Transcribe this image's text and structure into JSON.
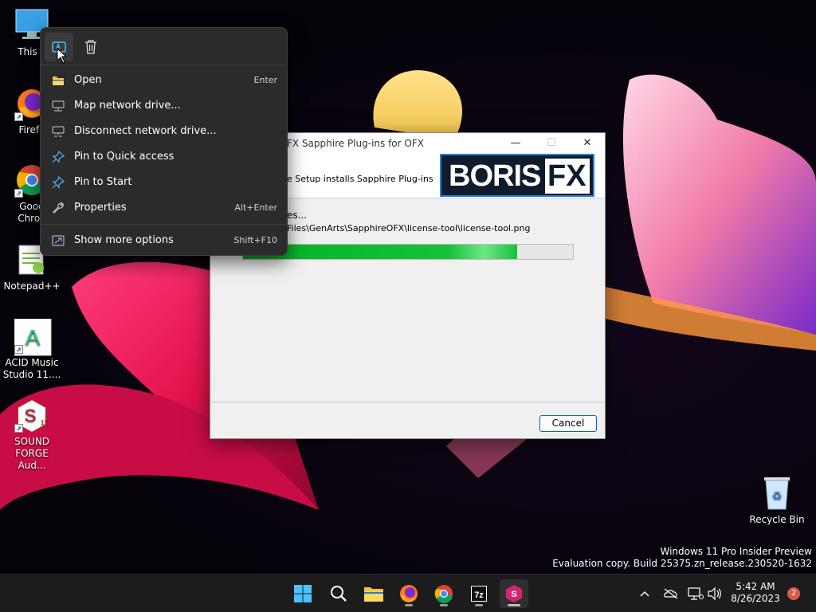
{
  "desktop": {
    "icons": [
      {
        "label": "This P",
        "icon": "monitor-icon"
      },
      {
        "label": "Firefo",
        "icon": "firefox-icon"
      },
      {
        "label": "Goog\nChron",
        "icon": "chrome-icon"
      },
      {
        "label": "Notepad++",
        "icon": "notepadpp-icon"
      },
      {
        "label": "ACID Music\nStudio 11....",
        "icon": "acid-icon"
      },
      {
        "label": "SOUND\nFORGE Aud...",
        "icon": "soundforge-icon"
      }
    ],
    "recycle_bin": {
      "label": "Recycle Bin",
      "icon": "recycle-bin-icon"
    }
  },
  "installer": {
    "title": "FX Sapphire Plug-ins for OFX",
    "header_desc": "e Setup installs Sapphire Plug-ins",
    "logo": {
      "left": "BORIS",
      "right": "FX"
    },
    "status": "es...",
    "path": "Files\\GenArts\\SapphireOFX\\license-tool\\license-tool.png",
    "progress": 0.83,
    "cancel_label": "Cancel"
  },
  "context_menu": {
    "top_buttons": [
      {
        "name": "rename",
        "icon": "rename-icon"
      },
      {
        "name": "delete",
        "icon": "trash-icon"
      }
    ],
    "items": [
      {
        "label": "Open",
        "shortcut": "Enter",
        "icon": "folder-icon"
      },
      {
        "label": "Map network drive...",
        "shortcut": "",
        "icon": "network-drive-icon"
      },
      {
        "label": "Disconnect network drive...",
        "shortcut": "",
        "icon": "disconnect-drive-icon"
      },
      {
        "label": "Pin to Quick access",
        "shortcut": "",
        "icon": "pin-icon"
      },
      {
        "label": "Pin to Start",
        "shortcut": "",
        "icon": "pin-start-icon"
      },
      {
        "label": "Properties",
        "shortcut": "Alt+Enter",
        "icon": "wrench-icon"
      },
      {
        "label": "Show more options",
        "shortcut": "Shift+F10",
        "icon": "more-options-icon"
      }
    ]
  },
  "watermark": {
    "line1": "Windows 11 Pro Insider Preview",
    "line2": "Evaluation copy. Build 25375.zn_release.230520-1632"
  },
  "taskbar": {
    "apps": [
      "start-icon",
      "search-icon",
      "file-explorer-icon",
      "firefox-icon",
      "chrome-icon",
      "7zip-icon",
      "sapphire-icon"
    ],
    "seven_zip_label": "7z",
    "sapphire_label": "S",
    "clock": {
      "time": "5:42 AM",
      "date": "8/26/2023"
    },
    "notification_count": "2"
  }
}
